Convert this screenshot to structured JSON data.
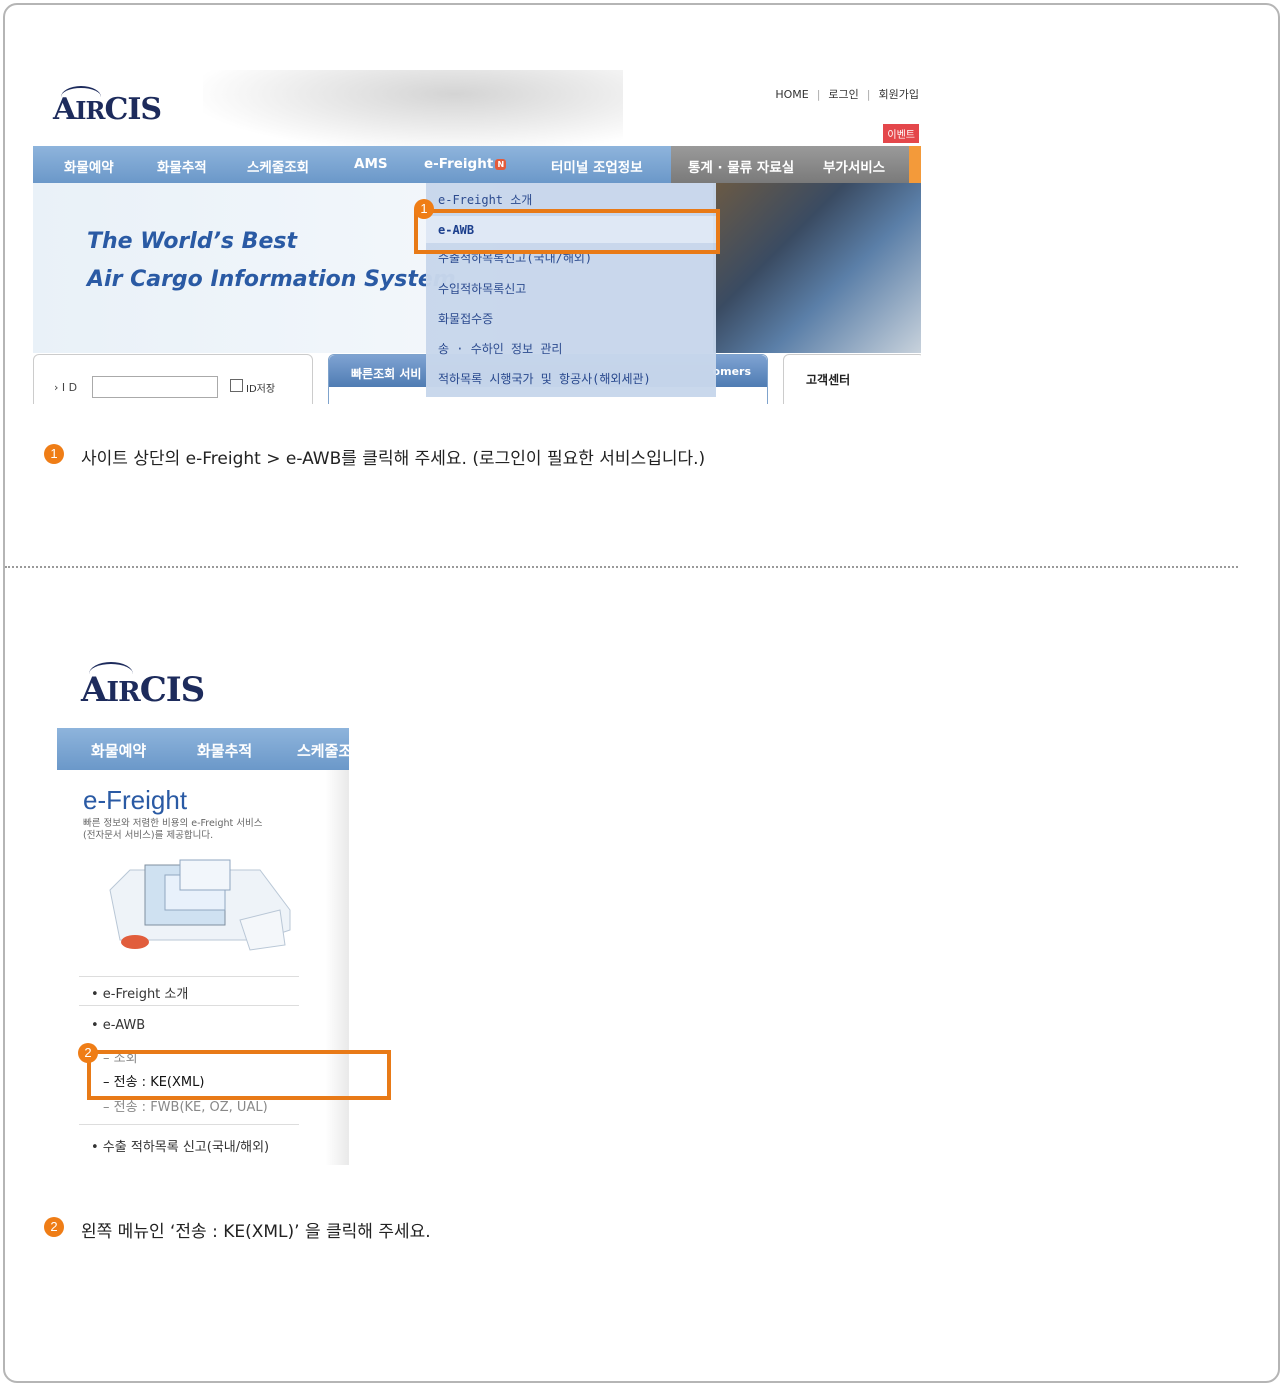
{
  "screen1": {
    "logo": {
      "main": "A",
      "small": "IR",
      "tail": "CIS"
    },
    "top_links": [
      "HOME",
      "로그인",
      "회원가입"
    ],
    "event_badge": "이벤트",
    "nav": [
      {
        "label": "화물예약"
      },
      {
        "label": "화물추적"
      },
      {
        "label": "스케줄조회"
      },
      {
        "label": "AMS"
      },
      {
        "label": "e-Freight",
        "badge": "N"
      },
      {
        "label": "터미널 조업정보"
      },
      {
        "label": "통계 · 물류 자료실"
      },
      {
        "label": "부가서비스"
      }
    ],
    "banner": {
      "line1": "The World’s Best",
      "line2": "Air Cargo Information System"
    },
    "login": {
      "id_label": "› I D",
      "save_label": "ID저장"
    },
    "quick_title": "빠른조회 서비",
    "customers_partial": "omers",
    "customer_center": "고객센터",
    "dropdown": [
      "e-Freight 소개",
      "e-AWB",
      "수출적하목록신고(국내/해외)",
      "수입적하목록신고",
      "화물접수증",
      "송 · 수하인 정보 관리",
      "적하목록 시행국가 및 항공사(해외세관)"
    ]
  },
  "step1": {
    "number": "1",
    "text": "사이트 상단의 e-Freight > e-AWB를 클릭해 주세요. (로그인이 필요한 서비스입니다.)"
  },
  "screen2": {
    "logo": {
      "main": "A",
      "small": "IR",
      "tail": "CIS"
    },
    "nav": [
      "화물예약",
      "화물추적",
      "스케줄조"
    ],
    "section_title": "e-Freight",
    "section_desc1": "빠른 정보와 저렴한 비용의 e-Freight 서비스",
    "section_desc2": "(전자문서 서비스)를 제공합니다.",
    "menu": [
      "• e-Freight 소개",
      "• e-AWB",
      "– 조회",
      "– 전송 : KE(XML)",
      "– 전송 : FWB(KE, OZ, UAL)",
      "• 수출 적하목록 신고(국내/해외)"
    ]
  },
  "step2": {
    "number": "2",
    "text": "왼쪽 메뉴인 ‘전송 : KE(XML)’ 을 클릭해 주세요."
  },
  "colors": {
    "accent": "#ef7d16",
    "nav_blue": "#7aa5d4",
    "link_blue": "#26468c"
  }
}
